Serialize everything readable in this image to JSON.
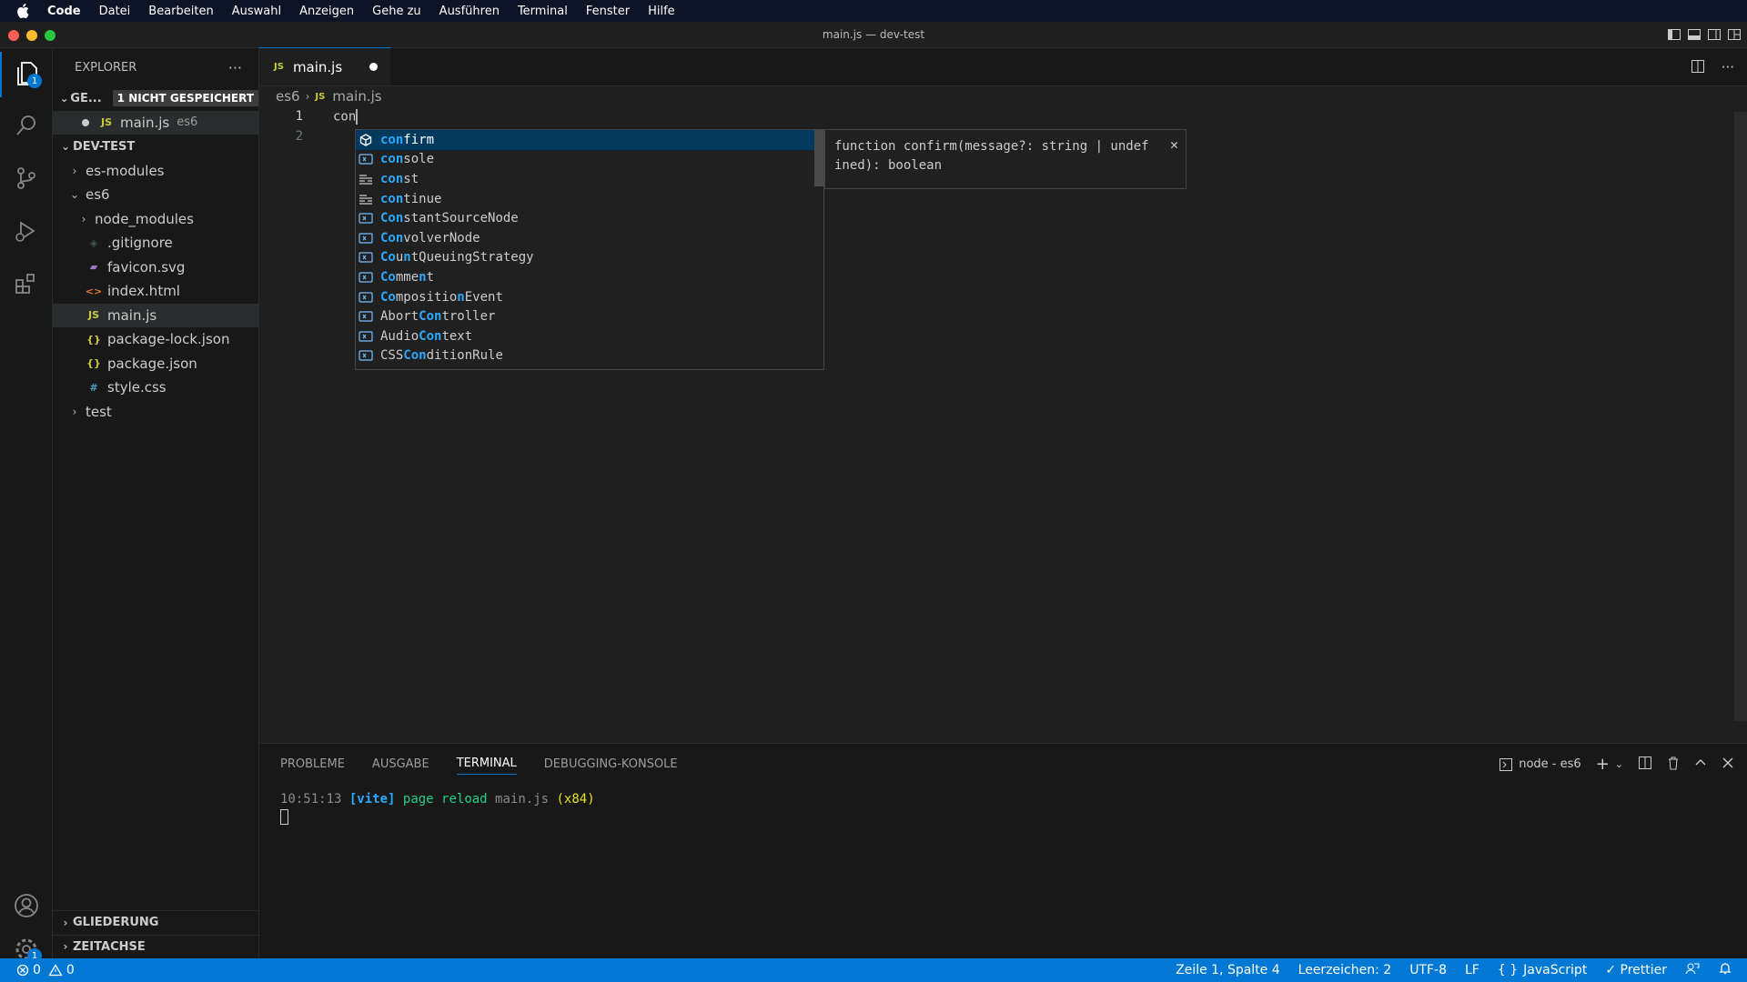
{
  "menubar": {
    "app": "Code",
    "items": [
      "Datei",
      "Bearbeiten",
      "Auswahl",
      "Anzeigen",
      "Gehe zu",
      "Ausführen",
      "Terminal",
      "Fenster",
      "Hilfe"
    ]
  },
  "window": {
    "title": "main.js — dev-test"
  },
  "activity": {
    "explorer_badge": "1",
    "settings_badge": "1"
  },
  "sidebar": {
    "title": "EXPLORER",
    "more": "···",
    "open_editors": {
      "label": "GE...",
      "badge": "1 NICHT GESPEICHERT",
      "file": "main.js",
      "folder": "es6"
    },
    "workspace": "DEV-TEST",
    "tree": [
      {
        "name": "es-modules",
        "type": "folder",
        "depth": 1,
        "open": false
      },
      {
        "name": "es6",
        "type": "folder",
        "depth": 1,
        "open": true
      },
      {
        "name": "node_modules",
        "type": "folder",
        "depth": 2,
        "open": false
      },
      {
        "name": ".gitignore",
        "type": "git",
        "depth": 2
      },
      {
        "name": "favicon.svg",
        "type": "svg",
        "depth": 2
      },
      {
        "name": "index.html",
        "type": "html",
        "depth": 2
      },
      {
        "name": "main.js",
        "type": "js",
        "depth": 2,
        "selected": true
      },
      {
        "name": "package-lock.json",
        "type": "json",
        "depth": 2
      },
      {
        "name": "package.json",
        "type": "json",
        "depth": 2
      },
      {
        "name": "style.css",
        "type": "css",
        "depth": 2
      },
      {
        "name": "test",
        "type": "folder",
        "depth": 1,
        "open": false
      }
    ],
    "bottom": {
      "outline": "GLIEDERUNG",
      "timeline": "ZEITACHSE"
    }
  },
  "editor": {
    "tab": {
      "label": "main.js",
      "icon": "JS"
    },
    "breadcrumb": {
      "folder": "es6",
      "file": "main.js",
      "icon": "JS"
    },
    "lines": [
      {
        "num": "1",
        "text": "con"
      },
      {
        "num": "2",
        "text": ""
      }
    ]
  },
  "suggest": {
    "items": [
      {
        "pre": "",
        "hl": "con",
        "post": "firm",
        "kind": "method-icon"
      },
      {
        "pre": "",
        "hl": "con",
        "post": "sole",
        "kind": "variable-icon"
      },
      {
        "pre": "",
        "hl": "con",
        "post": "st",
        "kind": "keyword-icon"
      },
      {
        "pre": "",
        "hl": "con",
        "post": "tinue",
        "kind": "keyword-icon"
      },
      {
        "pre": "",
        "hl": "Con",
        "post": "stantSourceNode",
        "kind": "variable-icon"
      },
      {
        "pre": "",
        "hl": "Con",
        "post": "volverNode",
        "kind": "variable-icon"
      },
      {
        "pre": "",
        "hl": "Co",
        "post": "u",
        "hl2": "n",
        "post2": "tQueuingStrategy",
        "kind": "variable-icon"
      },
      {
        "pre": "",
        "hl": "Co",
        "post": "mme",
        "hl2": "n",
        "post2": "t",
        "kind": "variable-icon"
      },
      {
        "pre": "",
        "hl": "Co",
        "post": "mpositio",
        "hl2": "n",
        "post2": "Event",
        "kind": "variable-icon"
      },
      {
        "pre": "Abort",
        "hl": "Con",
        "post": "troller",
        "kind": "variable-icon"
      },
      {
        "pre": "Audio",
        "hl": "Con",
        "post": "text",
        "kind": "variable-icon"
      },
      {
        "pre": "CSS",
        "hl": "Con",
        "post": "ditionRule",
        "kind": "variable-icon"
      }
    ],
    "details": {
      "line1": "function confirm(message?: string | undef",
      "line2": "ined): boolean",
      "close": "✕"
    }
  },
  "panel": {
    "tabs": [
      "PROBLEME",
      "AUSGABE",
      "TERMINAL",
      "DEBUGGING-KONSOLE"
    ],
    "active_tab": "TERMINAL",
    "terminal_name": "node - es6",
    "terminal": {
      "time": "10:51:13",
      "tag": "[vite]",
      "msg": "page reload",
      "file": "main.js",
      "count": "(x84)"
    }
  },
  "statusbar": {
    "errors": "0",
    "warnings": "0",
    "position": "Zeile 1, Spalte 4",
    "indent": "Leerzeichen: 2",
    "encoding": "UTF-8",
    "eol": "LF",
    "language": "JavaScript",
    "prettier": "✓ Prettier"
  },
  "colors": {
    "accent": "#0078d4",
    "highlight": "#2aaaff",
    "selection": "#04395e"
  }
}
